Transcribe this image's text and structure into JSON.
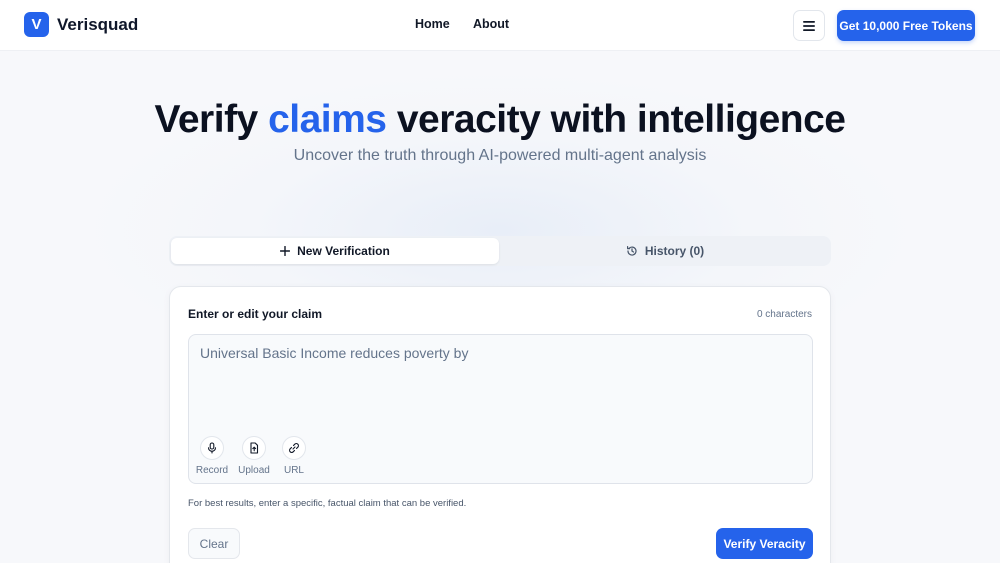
{
  "header": {
    "logo_letter": "V",
    "brand": "Verisquad",
    "nav": {
      "home": "Home",
      "about": "About"
    },
    "menu_icon": "hamburger-menu-icon",
    "cta": "Get 10,000 Free Tokens"
  },
  "hero": {
    "title_before": "Verify ",
    "title_accent": "claims",
    "title_after": " veracity with intelligence",
    "subtitle": "Uncover the truth through AI-powered multi-agent analysis"
  },
  "tabs": {
    "new": {
      "label": "New Verification",
      "icon": "plus-icon"
    },
    "history": {
      "label": "History (0)",
      "icon": "history-icon"
    }
  },
  "form": {
    "label": "Enter or edit your claim",
    "char_count": "0 characters",
    "placeholder": "Universal Basic Income reduces poverty by",
    "tools": [
      {
        "label": "Record",
        "icon": "microphone-icon"
      },
      {
        "label": "Upload",
        "icon": "file-upload-icon"
      },
      {
        "label": "URL",
        "icon": "link-icon"
      }
    ],
    "hint": "For best results, enter a specific, factual claim that can be verified.",
    "clear": "Clear",
    "verify": "Verify Veracity"
  },
  "colors": {
    "accent": "#2563eb",
    "text": "#0f172a",
    "muted": "#64748b",
    "background": "#f7f8fb"
  }
}
